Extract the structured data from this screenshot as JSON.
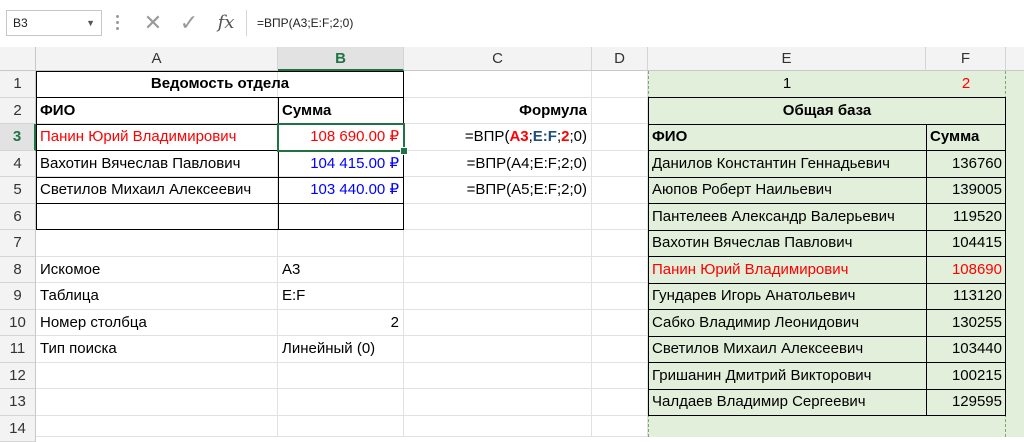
{
  "formula_bar": {
    "name_box": "B3",
    "formula": "=ВПР(A3;E:F;2;0)"
  },
  "columns": [
    "A",
    "B",
    "C",
    "D",
    "E",
    "F"
  ],
  "rows": [
    "1",
    "2",
    "3",
    "4",
    "5",
    "6",
    "7",
    "8",
    "9",
    "10",
    "11",
    "12",
    "13",
    "14"
  ],
  "sheet": {
    "a1": "Ведомость отдела",
    "a2": "ФИО",
    "b2": "Сумма",
    "c2": "Формула",
    "a3": "Панин Юрий Владимирович",
    "b3": "108 690.00 ₽",
    "c3": {
      "p1": "=ВПР(",
      "p2": "A3",
      "p3": ";",
      "p4": "E:F",
      "p5": ";",
      "p6": "2",
      "p7": ";0)"
    },
    "a4": "Вахотин Вячеслав Павлович",
    "b4": "104 415.00 ₽",
    "c4": "=ВПР(A4;E:F;2;0)",
    "a5": "Светилов Михаил Алексеевич",
    "b5": "103 440.00 ₽",
    "c5": "=ВПР(A5;E:F;2;0)",
    "a8": "Искомое",
    "b8": "A3",
    "a9": "Таблица",
    "b9": "E:F",
    "a10": "Номер столбца",
    "b10": "2",
    "a11": "Тип поиска",
    "b11": "Линейный (0)",
    "e1": "1",
    "f1": "2",
    "e2": "Общая база",
    "e3": "ФИО",
    "f3": "Сумма",
    "base": [
      {
        "name": "Данилов Константин Геннадьевич",
        "sum": "136760"
      },
      {
        "name": "Аюпов Роберт Наильевич",
        "sum": "139005"
      },
      {
        "name": "Пантелеев Александр Валерьевич",
        "sum": "119520"
      },
      {
        "name": "Вахотин Вячеслав Павлович",
        "sum": "104415"
      },
      {
        "name": "Панин Юрий Владимирович",
        "sum": "108690"
      },
      {
        "name": "Гундарев Игорь Анатольевич",
        "sum": "113120"
      },
      {
        "name": "Сабко Владимир Леонидович",
        "sum": "130255"
      },
      {
        "name": "Светилов Михаил Алексеевич",
        "sum": "103440"
      },
      {
        "name": "Гришанин Дмитрий Викторович",
        "sum": "100215"
      },
      {
        "name": "Чалдаев Владимир Сергеевич",
        "sum": "129595"
      }
    ]
  },
  "colors": {
    "accent": "#217346",
    "red": "#ff0000",
    "blue": "#0000ff",
    "base_fill": "#e2efda"
  }
}
